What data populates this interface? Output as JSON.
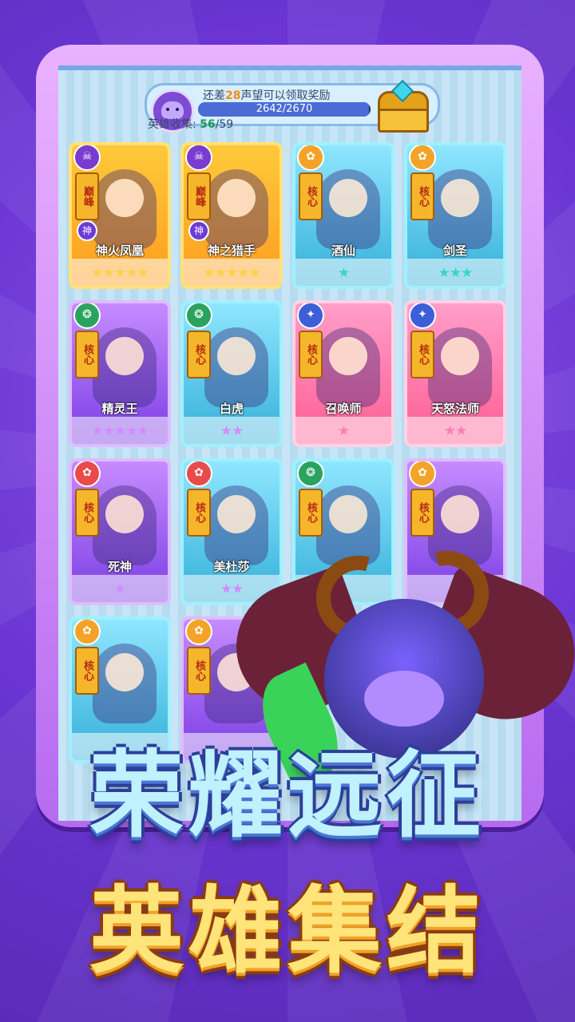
{
  "top": {
    "reward_prefix": "还差",
    "reward_count": "28",
    "reward_suffix": "声望可以领取奖励",
    "progress_text": "2642/2670",
    "progress_value": 0.9895,
    "collect_label": "英雄收集:",
    "collect_count": "56",
    "collect_total": "/59"
  },
  "cards": [
    {
      "name": "神火凤凰",
      "tag": "巅峰",
      "corner": "☠",
      "shen": "神",
      "stars": "★★★★★",
      "star_color": "#ffd04a"
    },
    {
      "name": "神之猎手",
      "tag": "巅峰",
      "corner": "☠",
      "shen": "神",
      "stars": "★★★★★",
      "star_color": "#ffd04a"
    },
    {
      "name": "酒仙",
      "tag": "核心",
      "corner": "✿",
      "stars": "★",
      "star_color": "#35d7c6"
    },
    {
      "name": "剑圣",
      "tag": "核心",
      "corner": "✿",
      "stars": "★★★",
      "star_color": "#35d7c6"
    },
    {
      "name": "精灵王",
      "tag": "核心",
      "corner": "❂",
      "stars": "★★★★★",
      "star_color": "#d58bff"
    },
    {
      "name": "白虎",
      "tag": "核心",
      "corner": "❂",
      "stars": "★★",
      "star_color": "#d58bff"
    },
    {
      "name": "召唤师",
      "tag": "核心",
      "corner": "✦",
      "stars": "★",
      "star_color": "#ff7fb3"
    },
    {
      "name": "天怒法师",
      "tag": "核心",
      "corner": "✦",
      "stars": "★★",
      "star_color": "#ff7fb3"
    },
    {
      "name": "死神",
      "tag": "核心",
      "corner": "✿",
      "stars": "★",
      "star_color": "#d58bff"
    },
    {
      "name": "美杜莎",
      "tag": "核心",
      "corner": "✿",
      "stars": "★★",
      "star_color": "#d58bff"
    },
    {
      "name": "",
      "tag": "核心",
      "corner": "❂",
      "stars": "",
      "star_color": "#35d7c6"
    },
    {
      "name": "",
      "tag": "核心",
      "corner": "✿",
      "stars": "",
      "star_color": "#d58bff"
    },
    {
      "name": "",
      "tag": "核心",
      "corner": "✿",
      "stars": "",
      "star_color": "#35d7c6"
    },
    {
      "name": "",
      "tag": "核心",
      "corner": "✿",
      "stars": "",
      "star_color": "#d58bff"
    }
  ],
  "headline": {
    "line1": "荣耀远征",
    "line2": "英雄集结"
  }
}
